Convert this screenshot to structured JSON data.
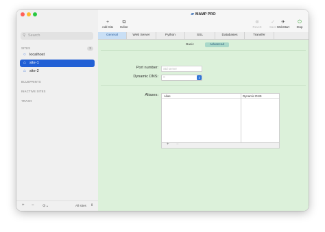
{
  "app": {
    "title": "MAMP PRO"
  },
  "sidebar": {
    "search_placeholder": "Search",
    "sections": {
      "sites": "SITES",
      "sites_count": "3",
      "blueprints": "BLUEPRINTS",
      "inactive_sites": "INACTIVE SITES",
      "trash": "TRASH"
    },
    "sites": [
      {
        "label": "localhost",
        "icon": "globe-icon",
        "selected": false
      },
      {
        "label": "site-1",
        "icon": "home-icon",
        "selected": true
      },
      {
        "label": "site-2",
        "icon": "home-icon",
        "selected": false
      }
    ],
    "footer": {
      "add": "+",
      "remove": "−",
      "more": "⊙⌄",
      "filter_label": "All sites",
      "filter_arrows": "⇕"
    }
  },
  "toolbar": {
    "add_site": "Add Site",
    "add_site_glyph": "+",
    "editor": "Editor",
    "editor_glyph": "⧉",
    "revert": "Revert",
    "revert_glyph": "⊗",
    "save": "Save",
    "save_glyph": "✓",
    "webstart": "WebStart",
    "webstart_glyph": "✈",
    "stop": "Stop",
    "stop_glyph": "⏻"
  },
  "tabs": [
    "General",
    "Web Server",
    "Python",
    "SSL",
    "Databases",
    "Transfer"
  ],
  "active_tab": "General",
  "general": {
    "segments": {
      "basic": "Basic",
      "advanced": "Advanced"
    },
    "port_label": "Port number:",
    "port_placeholder": "Std server",
    "dns_label": "Dynamic DNS:",
    "dns_value": "–",
    "dns_arrows": "⇕",
    "aliases_label": "Aliases:",
    "aliases_columns": [
      "Alias",
      "Dynamic DNS"
    ],
    "aliases_add": "+",
    "aliases_remove": "−"
  },
  "colors": {
    "accent": "#2260d5",
    "content_bg": "#dcf1da",
    "active_tab": "#c9dff5",
    "close": "#ff5f57",
    "minimize": "#febc2e",
    "zoom": "#28c840",
    "stop": "#3aa637"
  }
}
